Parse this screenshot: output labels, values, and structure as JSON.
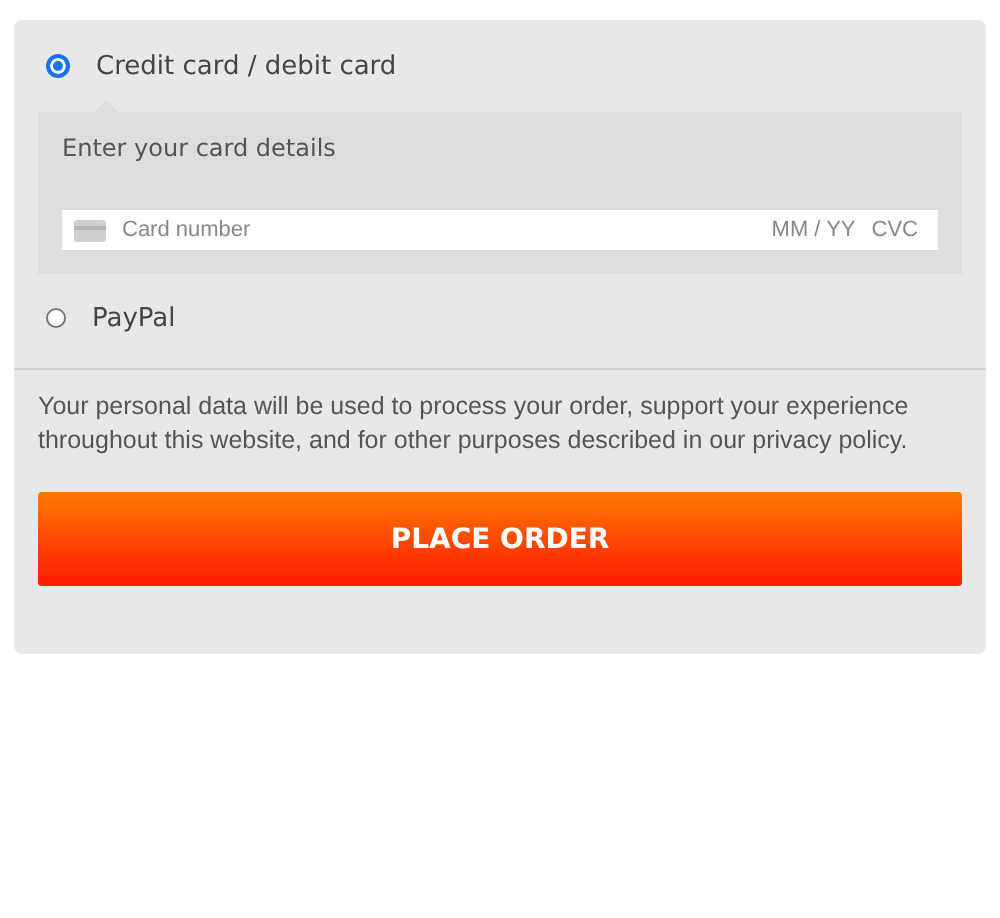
{
  "payment_methods": [
    {
      "label": "Credit card / debit card",
      "selected": true
    },
    {
      "label": "PayPal",
      "selected": false
    }
  ],
  "card_details": {
    "heading": "Enter your card details",
    "card_number": {
      "placeholder": "Card number"
    },
    "expiry": {
      "placeholder": "MM / YY"
    },
    "cvc": {
      "placeholder": "CVC"
    }
  },
  "privacy_notice": "Your personal data will be used to process your order, support your experience throughout this website, and for other purposes described in our privacy policy.",
  "place_order_button": "PLACE ORDER"
}
